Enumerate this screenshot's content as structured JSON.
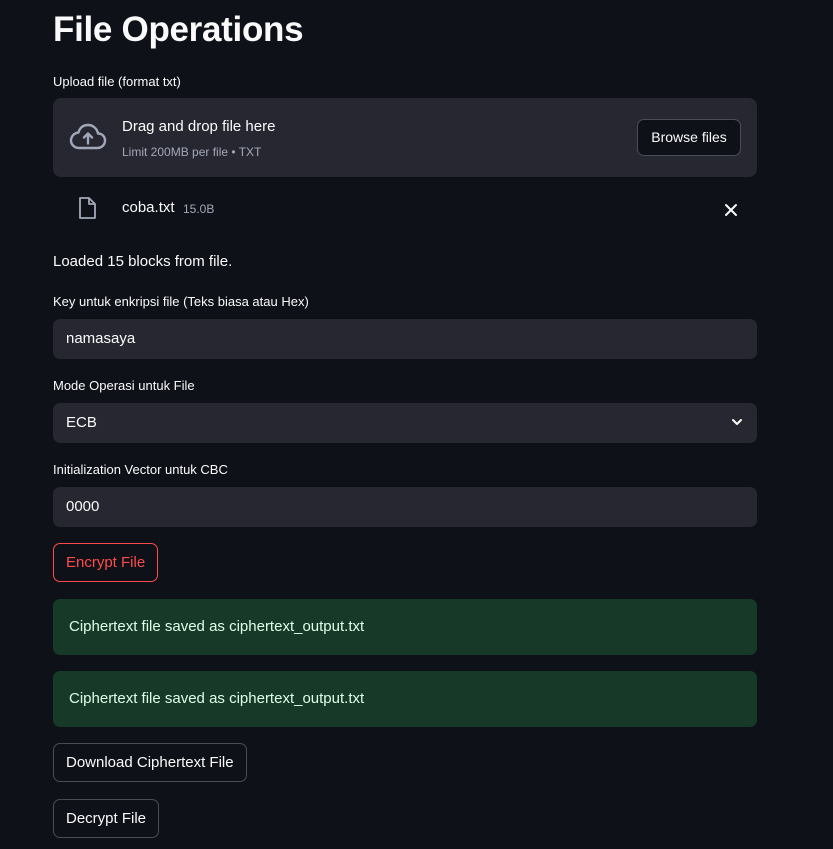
{
  "title": "File Operations",
  "upload": {
    "label": "Upload file (format txt)",
    "drop_title": "Drag and drop file here",
    "drop_subtitle": "Limit 200MB per file • TXT",
    "browse_label": "Browse files",
    "icon": "cloud-upload-icon"
  },
  "uploaded_file": {
    "name": "coba.txt",
    "size": "15.0B",
    "icon": "file-icon",
    "remove_icon": "close-icon"
  },
  "status_message": "Loaded 15 blocks from file.",
  "key_field": {
    "label": "Key untuk enkripsi file (Teks biasa atau Hex)",
    "value": "namasaya"
  },
  "mode_field": {
    "label": "Mode Operasi untuk File",
    "selected": "ECB",
    "icon": "chevron-down-icon"
  },
  "iv_field": {
    "label": "Initialization Vector untuk CBC",
    "value": "0000"
  },
  "buttons": {
    "encrypt": "Encrypt File",
    "download": "Download Ciphertext File",
    "decrypt": "Decrypt File"
  },
  "alerts": [
    "Ciphertext file saved as ciphertext_output.txt",
    "Ciphertext file saved as ciphertext_output.txt"
  ],
  "colors": {
    "background": "#0e1117",
    "surface": "#262730",
    "primary_red": "#ff4b4b",
    "success_bg": "#173928",
    "success_text": "#dffde9"
  }
}
